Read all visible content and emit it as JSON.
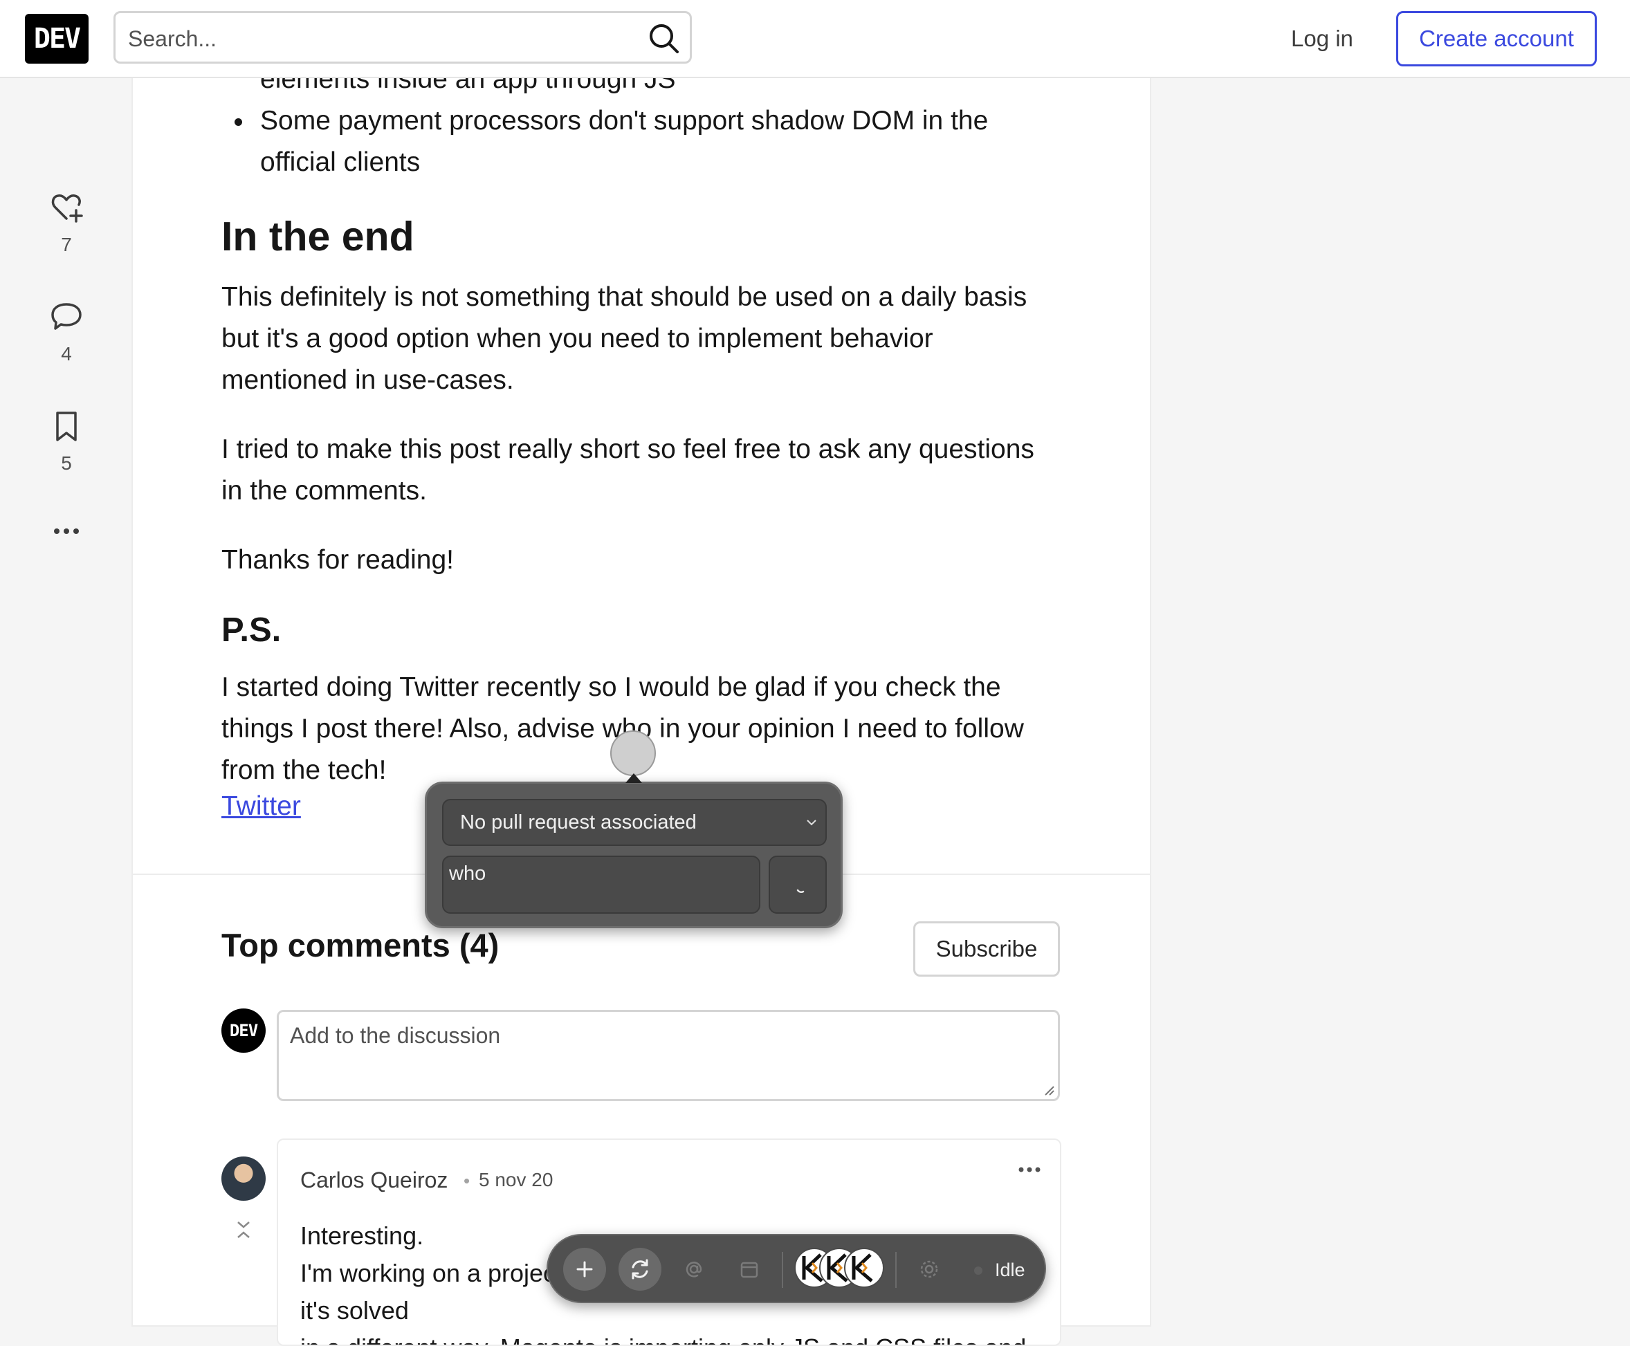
{
  "header": {
    "logo": "DEV",
    "search_placeholder": "Search...",
    "login_label": "Log in",
    "create_account_label": "Create account"
  },
  "sidebar": {
    "reactions_count": "7",
    "comments_count": "4",
    "bookmarks_count": "5"
  },
  "article": {
    "bullet_fragment": "elements inside an app through JS",
    "bullets": [
      "Some payment processors don't support shadow DOM in the official clients"
    ],
    "end_heading": "In the end",
    "end_paragraph": "This definitely is not something that should be used on a daily basis but it's a good option when you need to implement behavior mentioned in use-cases.",
    "short_post_paragraph": "I tried to make this post really short so feel free to ask any questions in the comments.",
    "thanks": "Thanks for reading!",
    "ps_heading": "P.S.",
    "ps_paragraph": "I started doing Twitter recently so I would be glad if you check the things I post there! Also, advise who in your opinion I need to follow from the tech!",
    "twitter_link": "Twitter"
  },
  "comments": {
    "title": "Top comments (4)",
    "subscribe_label": "Subscribe",
    "user_avatar_text": "DEV",
    "discussion_placeholder": "Add to the discussion",
    "items": [
      {
        "author": "Carlos Queiroz",
        "separator": "•",
        "date": "5 nov 20",
        "body_line1": "Interesting.",
        "body_line2": "I'm working on a project in Magento that has the same issue, but it's solved",
        "body_line3": "in a different way. Magento is importing only JS and CSS files and"
      }
    ]
  },
  "popup": {
    "pull_request_select": "No pull request associated",
    "input_value": "who"
  },
  "toolbar": {
    "status": "Idle",
    "avatar_letters": [
      "K",
      "K",
      "K"
    ]
  },
  "colors": {
    "accent": "#3b49df",
    "overlay_bg": "#5a5a5a",
    "toolbar_bg": "#505050"
  }
}
